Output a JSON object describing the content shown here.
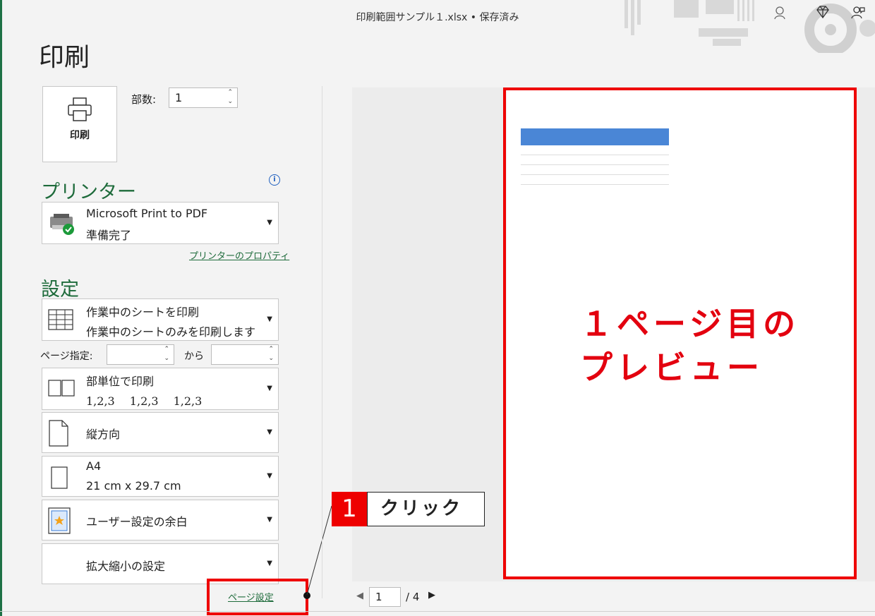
{
  "titlebar": {
    "document": "印刷範囲サンプル１.xlsx • 保存済み"
  },
  "page_title": "印刷",
  "print_button": {
    "label": "印刷"
  },
  "copies": {
    "label": "部数:",
    "value": "1"
  },
  "printer": {
    "heading": "プリンター",
    "name": "Microsoft Print to PDF",
    "status": "準備完了",
    "properties_link": "プリンターのプロパティ"
  },
  "settings": {
    "heading": "設定",
    "scope": {
      "line1": "作業中のシートを印刷",
      "line2": "作業中のシートのみを印刷します"
    },
    "pages": {
      "label": "ページ指定:",
      "to_label": "から",
      "from_value": "",
      "to_value": ""
    },
    "collate": {
      "line1": "部単位で印刷",
      "line2": "1,2,3　 1,2,3　 1,2,3"
    },
    "orientation": {
      "line1": "縦方向"
    },
    "paper": {
      "line1": "A4",
      "line2": "21 cm x 29.7 cm"
    },
    "margins": {
      "line1": "ユーザー設定の余白"
    },
    "scaling": {
      "line1": "拡大縮小の設定"
    },
    "page_setup_link": "ページ設定"
  },
  "preview": {
    "annotation_line1": "１ページ目の",
    "annotation_line2": "プレビュー",
    "table": {
      "headers": [
        "",
        "",
        "",
        "",
        ""
      ],
      "rows": [
        [
          "",
          "",
          "",
          "",
          ""
        ],
        [
          "",
          "",
          "",
          "",
          ""
        ],
        [
          "",
          "",
          "",
          "",
          ""
        ],
        [
          "",
          "",
          "",
          "",
          ""
        ]
      ]
    }
  },
  "callout": {
    "number": "1",
    "text": "クリック"
  },
  "pager": {
    "current": "1",
    "total": "/ 4"
  },
  "colors": {
    "accent_green": "#1e6b3b",
    "highlight_red": "#e00000",
    "table_header_blue": "#4a86d6"
  }
}
